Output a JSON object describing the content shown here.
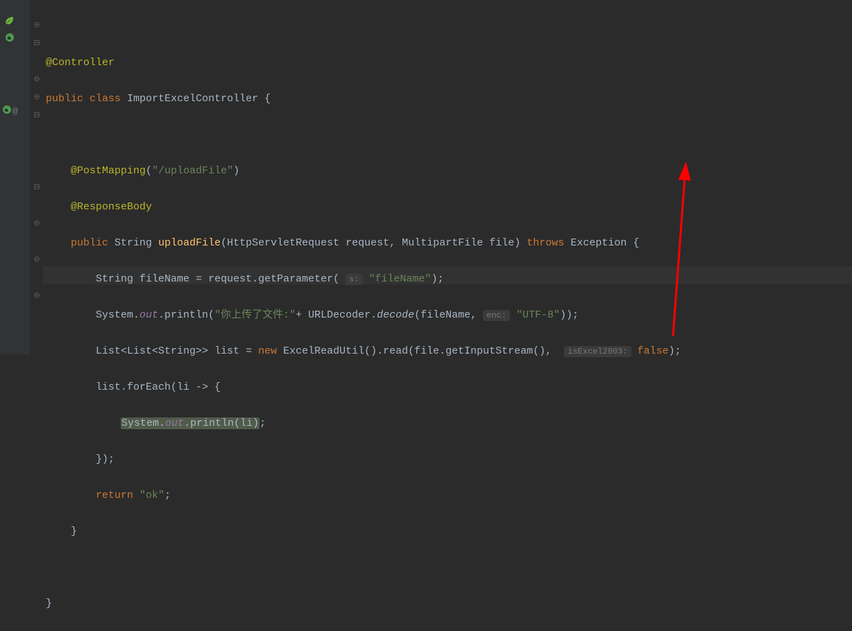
{
  "code": {
    "annotation_controller": "@Controller",
    "public": "public",
    "class_kw": "class",
    "class_name": "ImportExcelController",
    "annotation_postmapping": "@PostMapping",
    "postmapping_value": "\"/uploadFile\"",
    "annotation_responsebody": "@ResponseBody",
    "return_type": "String",
    "method_name": "uploadFile",
    "param1_type": "HttpServletRequest",
    "param1_name": "request",
    "param2_type": "MultipartFile",
    "param2_name": "file",
    "throws_kw": "throws",
    "exception_type": "Exception",
    "line1_type": "String",
    "line1_var": "fileName",
    "line1_expr": "request.getParameter(",
    "hint_s": "s:",
    "line1_str": "\"fileName\"",
    "system": "System.",
    "out": "out",
    "println": ".println(",
    "line2_str1": "\"你上传了文件:\"",
    "line2_plus": "+ URLDecoder.",
    "decode": "decode",
    "line2_call2": "(fileName,",
    "hint_enc": "enc:",
    "line2_str2": "\"UTF-8\"",
    "list_type": "List<List<String>>",
    "list_var": "list",
    "new_kw": "new",
    "excel_util": "ExcelReadUtil().read(file.getInputStream(),",
    "hint_excel": "isExcel2003:",
    "false_kw": "false",
    "foreach": "list.forEach(li -> {",
    "println_li": "(li)",
    "foreach_close": "});",
    "return_kw": "return",
    "return_val": "\"ok\"",
    "brace_open": "{",
    "brace_close": "}",
    "semicolon": ";",
    "paren_close": ")",
    "paren_close_semi": ");",
    "paren_open": "(",
    "eq": " = "
  }
}
